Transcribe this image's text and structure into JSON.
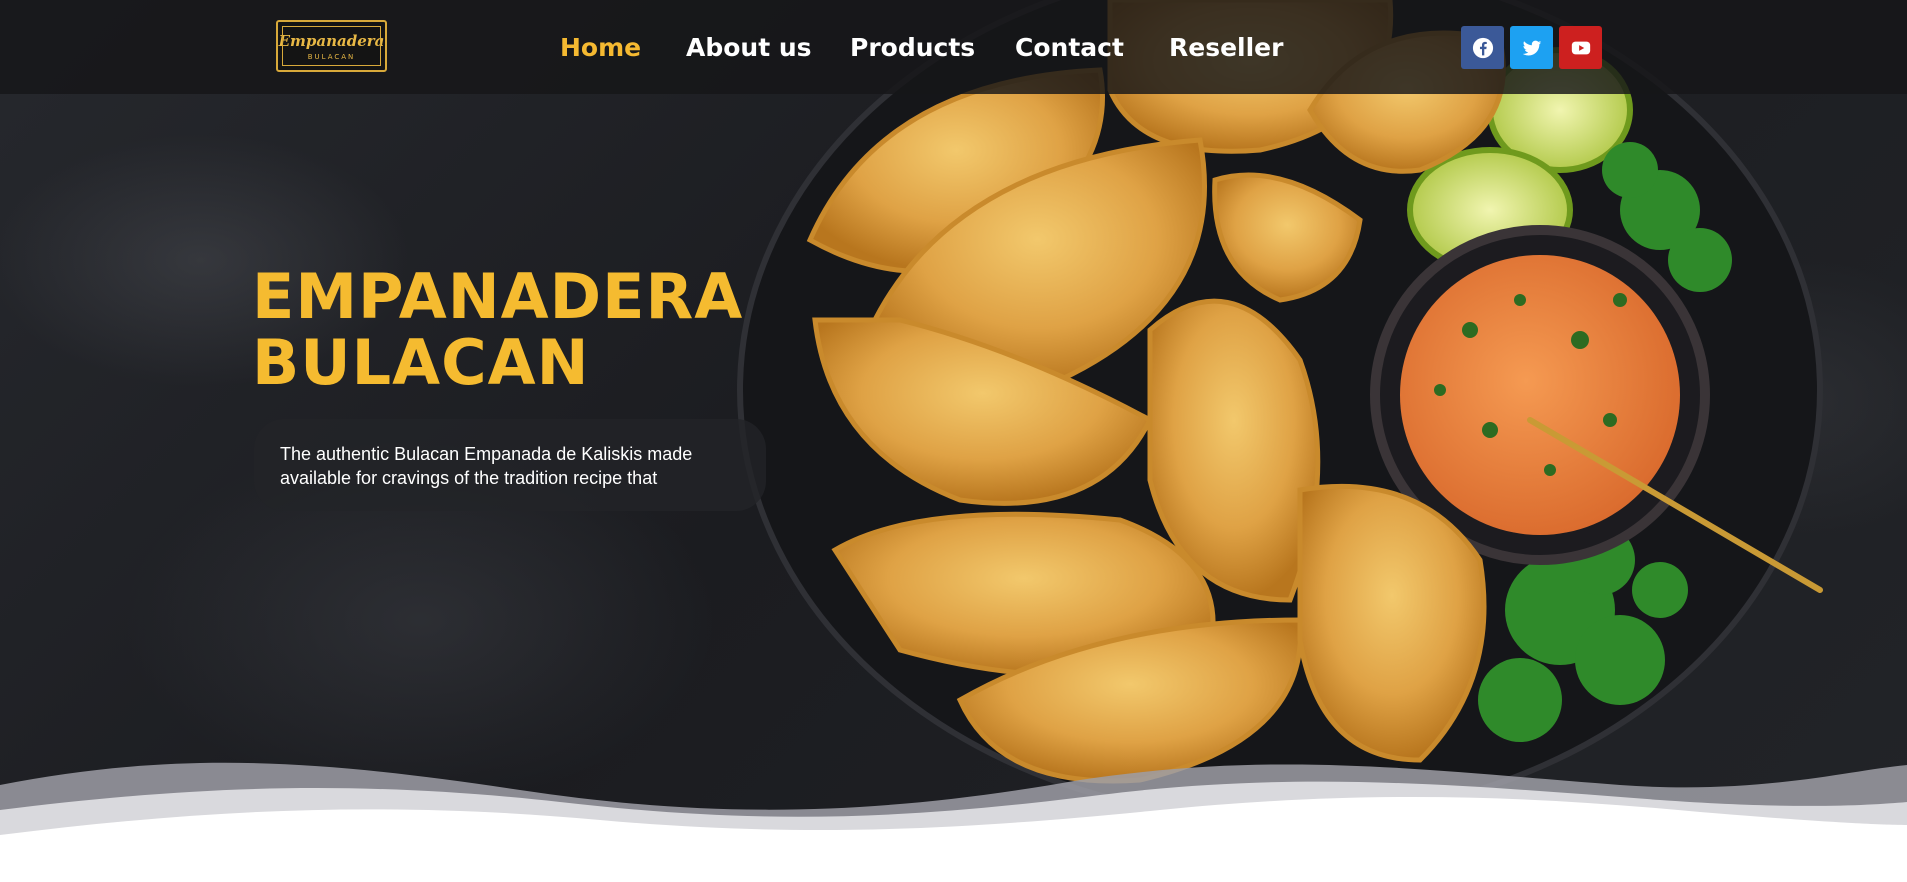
{
  "header": {
    "logo": {
      "name": "Empanadera",
      "sub": "BULACAN"
    },
    "nav": [
      {
        "label": "Home",
        "active": true
      },
      {
        "label": "About us",
        "active": false
      },
      {
        "label": "Products",
        "active": false
      },
      {
        "label": "Contact",
        "active": false
      },
      {
        "label": "Reseller",
        "active": false
      }
    ],
    "social": [
      {
        "icon": "facebook-icon",
        "color": "#3b5998"
      },
      {
        "icon": "twitter-icon",
        "color": "#1da1f2"
      },
      {
        "icon": "youtube-icon",
        "color": "#cd201f"
      }
    ]
  },
  "hero": {
    "title_line1": "EMPANADERA",
    "title_line2": "BULACAN",
    "description": "The authentic Bulacan Empanada de Kaliskis made available for cravings of the tradition recipe that",
    "image": "empanadas-on-plate-with-dipping-sauce-lime-parsley"
  },
  "colors": {
    "accent": "#f5b931",
    "header_bg": "#161618",
    "background": "#1f2024"
  }
}
